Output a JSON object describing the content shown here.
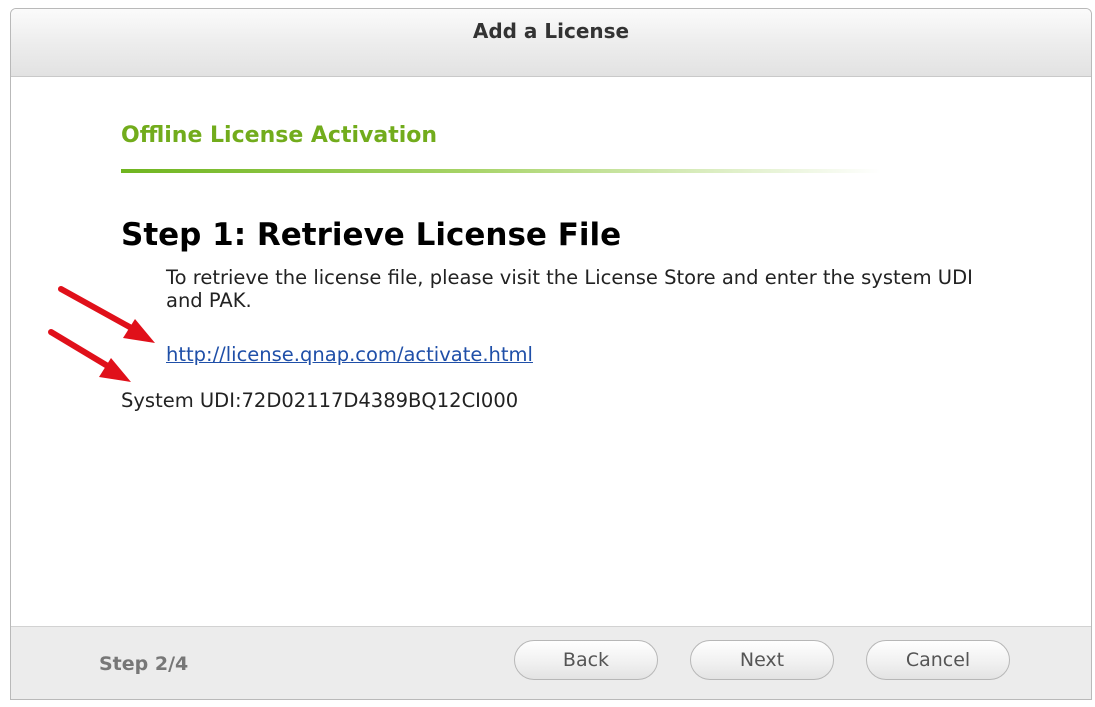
{
  "window": {
    "title": "Add a License"
  },
  "main": {
    "section_title": "Offline License Activation",
    "step_heading": "Step 1: Retrieve License File",
    "instructions": "To retrieve the license file, please visit the License Store and enter the system UDI and PAK.",
    "link_text": "http://license.qnap.com/activate.html",
    "udi_text": "System UDI:72D02117D4389BQ12CI000"
  },
  "annotations": {
    "arrow_color": "#e0101a"
  },
  "footer": {
    "step_counter": "Step 2/4",
    "back_label": "Back",
    "next_label": "Next",
    "cancel_label": "Cancel"
  },
  "colors": {
    "accent_green": "#72ac1c",
    "link_blue": "#1f4fa8"
  }
}
